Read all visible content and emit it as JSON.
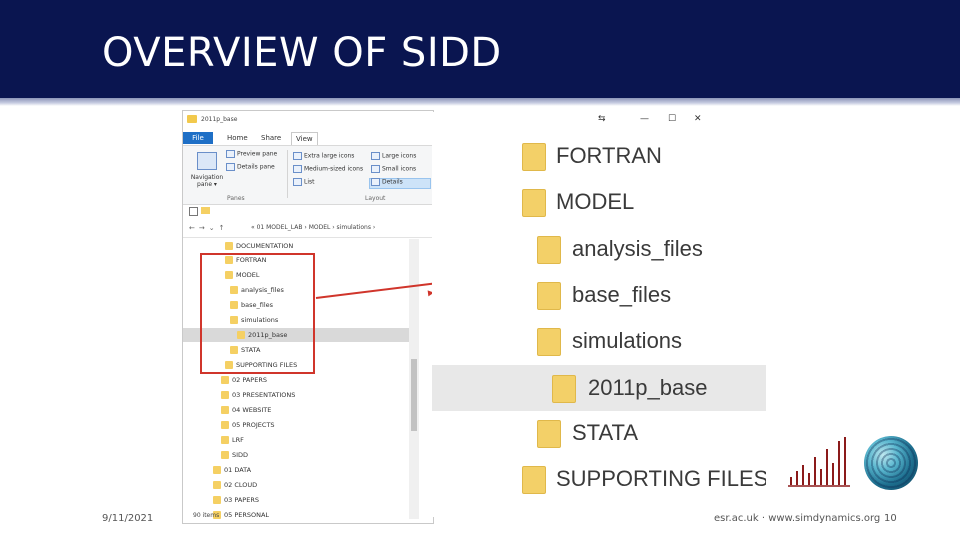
{
  "slide": {
    "title": "OVERVIEW OF SIDD",
    "date": "9/11/2021",
    "footer_center": "esr.ac.uk  ·  www.simdynamics.org",
    "page_number": "10",
    "brand_color": "#0a1550",
    "accent_color": "#d0352b"
  },
  "explorer": {
    "window_title": "2011p_base",
    "tabs": [
      "File",
      "Home",
      "Share",
      "View"
    ],
    "ribbon": {
      "nav_pane_label": "Navigation pane ▾",
      "preview_pane": "Preview pane",
      "details_pane": "Details pane",
      "panes_group": "Panes",
      "layout_group": "Layout",
      "layout_items": [
        "Extra large icons",
        "Large icons",
        "Medium-sized icons",
        "Small icons",
        "List",
        "Details"
      ]
    },
    "address_path": "« 01 MODEL_LAB  ›  MODEL  ›  simulations  ›",
    "tree": [
      "DOCUMENTATION",
      "FORTRAN",
      "MODEL",
      "analysis_files",
      "base_files",
      "simulations",
      "2011p_base",
      "STATA",
      "SUPPORTING FILES",
      "02 PAPERS",
      "03 PRESENTATIONS",
      "04 WEBSITE",
      "05 PROJECTS",
      "LRF",
      "SIDD",
      "01 DATA",
      "02 CLOUD",
      "03 PAPERS",
      "05 PERSONAL"
    ],
    "selected_item": "2011p_base",
    "status": "90 items"
  },
  "zoom": {
    "window_controls": [
      "⇆",
      "—",
      "☐",
      "✕"
    ],
    "items": [
      "FORTRAN",
      "MODEL",
      "analysis_files",
      "base_files",
      "simulations",
      "2011p_base",
      "STATA",
      "SUPPORTING FILES"
    ],
    "selected_item": "2011p_base"
  },
  "icons": [
    "folder-icon",
    "navigation-pane-icon",
    "back-arrow-icon",
    "forward-arrow-icon",
    "up-arrow-icon",
    "minimize-icon",
    "maximize-icon",
    "close-icon",
    "simdynamics-logo",
    "sphere-logo"
  ]
}
